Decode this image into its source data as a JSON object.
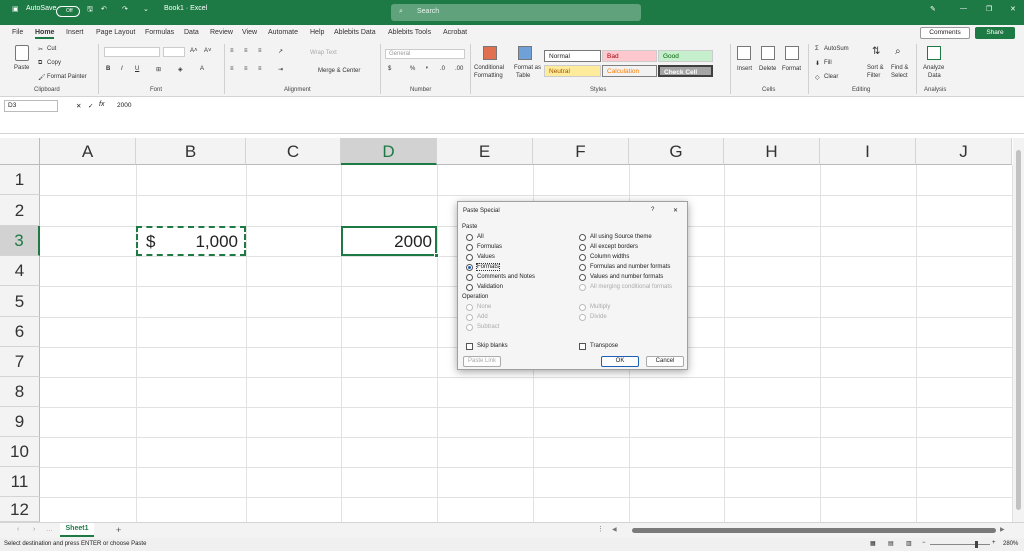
{
  "title": {
    "autosave": "AutoSave",
    "toggle": "Off",
    "doc": "Book1 · Excel",
    "search_placeholder": "Search"
  },
  "menu": [
    "File",
    "Home",
    "Insert",
    "Page Layout",
    "Formulas",
    "Data",
    "Review",
    "View",
    "Automate",
    "Help",
    "Ablebits Data",
    "Ablebits Tools",
    "Acrobat"
  ],
  "buttons": {
    "comments": "Comments",
    "share": "Share"
  },
  "ribbon": {
    "clipboard": {
      "paste": "Paste",
      "cut": "Cut",
      "copy": "Copy",
      "painter": "Format Painter",
      "label": "Clipboard"
    },
    "font": {
      "label": "Font",
      "bold": "B",
      "italic": "I",
      "underline": "U"
    },
    "alignment": {
      "wrap": "Wrap Text",
      "merge": "Merge & Center",
      "label": "Alignment"
    },
    "number": {
      "format": "General",
      "label": "Number",
      "currency": "$",
      "percent": "%",
      "comma": "❜"
    },
    "styles": {
      "cond1": "Conditional",
      "cond2": "Formatting",
      "table1": "Format as",
      "table2": "Table",
      "normal": "Normal",
      "bad": "Bad",
      "good": "Good",
      "neutral": "Neutral",
      "calc": "Calculation",
      "check": "Check Cell",
      "label": "Styles"
    },
    "cells": {
      "insert": "Insert",
      "delete": "Delete",
      "format": "Format",
      "label": "Cells"
    },
    "editing": {
      "autosum": "AutoSum",
      "fill": "Fill",
      "clear": "Clear",
      "sort1": "Sort &",
      "sort2": "Filter",
      "find1": "Find &",
      "find2": "Select",
      "label": "Editing"
    },
    "analysis": {
      "a1": "Analyze",
      "a2": "Data",
      "label": "Analysis"
    }
  },
  "formula_bar": {
    "cell": "D3",
    "fx": "fx",
    "value": "2000"
  },
  "columns": [
    "A",
    "B",
    "C",
    "D",
    "E",
    "F",
    "G",
    "H",
    "I",
    "J"
  ],
  "rows": [
    "1",
    "2",
    "3",
    "4",
    "5",
    "6",
    "7",
    "8",
    "9",
    "10",
    "11",
    "12"
  ],
  "cells": {
    "b3_symbol": "$",
    "b3_value": "1,000",
    "d3": "2000"
  },
  "dialog": {
    "title": "Paste Special",
    "help": "?",
    "close": "✕",
    "paste_header": "Paste",
    "paste_left": [
      "All",
      "Formulas",
      "Values",
      "Formats",
      "Comments and Notes",
      "Validation"
    ],
    "paste_right": [
      "All using Source theme",
      "All except borders",
      "Column widths",
      "Formulas and number formats",
      "Values and number formats",
      "All merging conditional formats"
    ],
    "operation_header": "Operation",
    "op_left": [
      "None",
      "Add",
      "Subtract"
    ],
    "op_right": [
      "Multiply",
      "Divide"
    ],
    "skip_blanks": "Skip blanks",
    "transpose": "Transpose",
    "paste_link": "Paste Link",
    "ok": "OK",
    "cancel": "Cancel"
  },
  "sheet_tab": "Sheet1",
  "status": {
    "message": "Select destination and press ENTER or choose Paste",
    "zoom": "280%"
  },
  "colors": {
    "brand": "#1e7a45",
    "good_bg": "#c6efce",
    "bad_bg": "#ffc7ce",
    "neutral_bg": "#ffeb9c"
  }
}
